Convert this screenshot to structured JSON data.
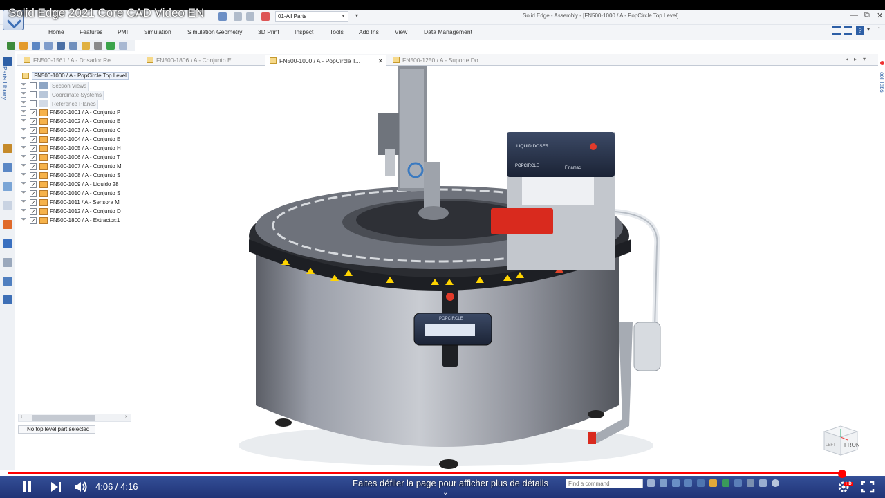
{
  "video": {
    "title": "Solid Edge 2021 Core CAD Video EN",
    "time_current": "4:06",
    "time_separator": " / ",
    "time_total": "4:16",
    "progress_fraction": 0.96,
    "scroll_hint": "Faites défiler la page pour afficher plus de détails",
    "hd_badge": "HD",
    "icons": {
      "play_pause": "pause-icon",
      "next": "next-icon",
      "volume": "volume-icon",
      "settings": "gear-icon",
      "miniplayer": "miniplayer-icon",
      "fullscreen": "fullscreen-icon"
    }
  },
  "app": {
    "window_title": "Solid Edge - Assembly - [FN500-1000 / A - PopCircle Top Level]",
    "parts_filter": "01-All Parts",
    "ribbon_tabs": [
      "Home",
      "Features",
      "PMI",
      "Simulation",
      "Simulation Geometry",
      "3D Print",
      "Inspect",
      "Tools",
      "Add Ins",
      "View",
      "Data Management"
    ],
    "parts_library_label": "Parts Library",
    "right_panel_label": "Tool Tabs"
  },
  "document_tabs": [
    {
      "label": "FN500-1561 / A - Dosador Re...",
      "active": false
    },
    {
      "label": "FN500-1806 / A - Conjunto E...",
      "active": false
    },
    {
      "label": "FN500-1000 / A - PopCircle T...",
      "active": true
    },
    {
      "label": "FN500-1250 / A - Suporte Do...",
      "active": false
    }
  ],
  "tree": {
    "root": "FN500-1000 / A - PopCircle Top Level",
    "reference_items": [
      "Section Views",
      "Coordinate Systems",
      "Reference Planes"
    ],
    "items": [
      "FN500-1001 / A - Conjunto P",
      "FN500-1002 / A - Conjunto E",
      "FN500-1003 / A - Conjunto C",
      "FN500-1004 / A - Conjunto E",
      "FN500-1005 / A - Conjunto H",
      "FN500-1006 / A - Conjunto T",
      "FN500-1007 / A - Conjunto M",
      "FN500-1008 / A - Conjunto S",
      "FN500-1009 / A - Liquido 28",
      "FN500-1010 / A - Conjunto S",
      "FN500-1011 / A - Sensora M",
      "FN500-1012 / A - Conjunto D",
      "FN500-1800 / A - Extractor:1"
    ],
    "status": "No top level part selected"
  },
  "command_finder": {
    "placeholder": "Find a command"
  },
  "model_labels": {
    "doser_panel_title": "LIQUID DOSER",
    "doser_brand": "POPCIRCLE",
    "doser_maker": "Finamac",
    "console_brand": "POPCIRCLE"
  },
  "viewcube": {
    "front": "FRONT",
    "left": "LEFT"
  },
  "colors": {
    "accent": "#2d5fa6",
    "progress": "#ff0000",
    "player_bar": "#1e3c8c"
  }
}
